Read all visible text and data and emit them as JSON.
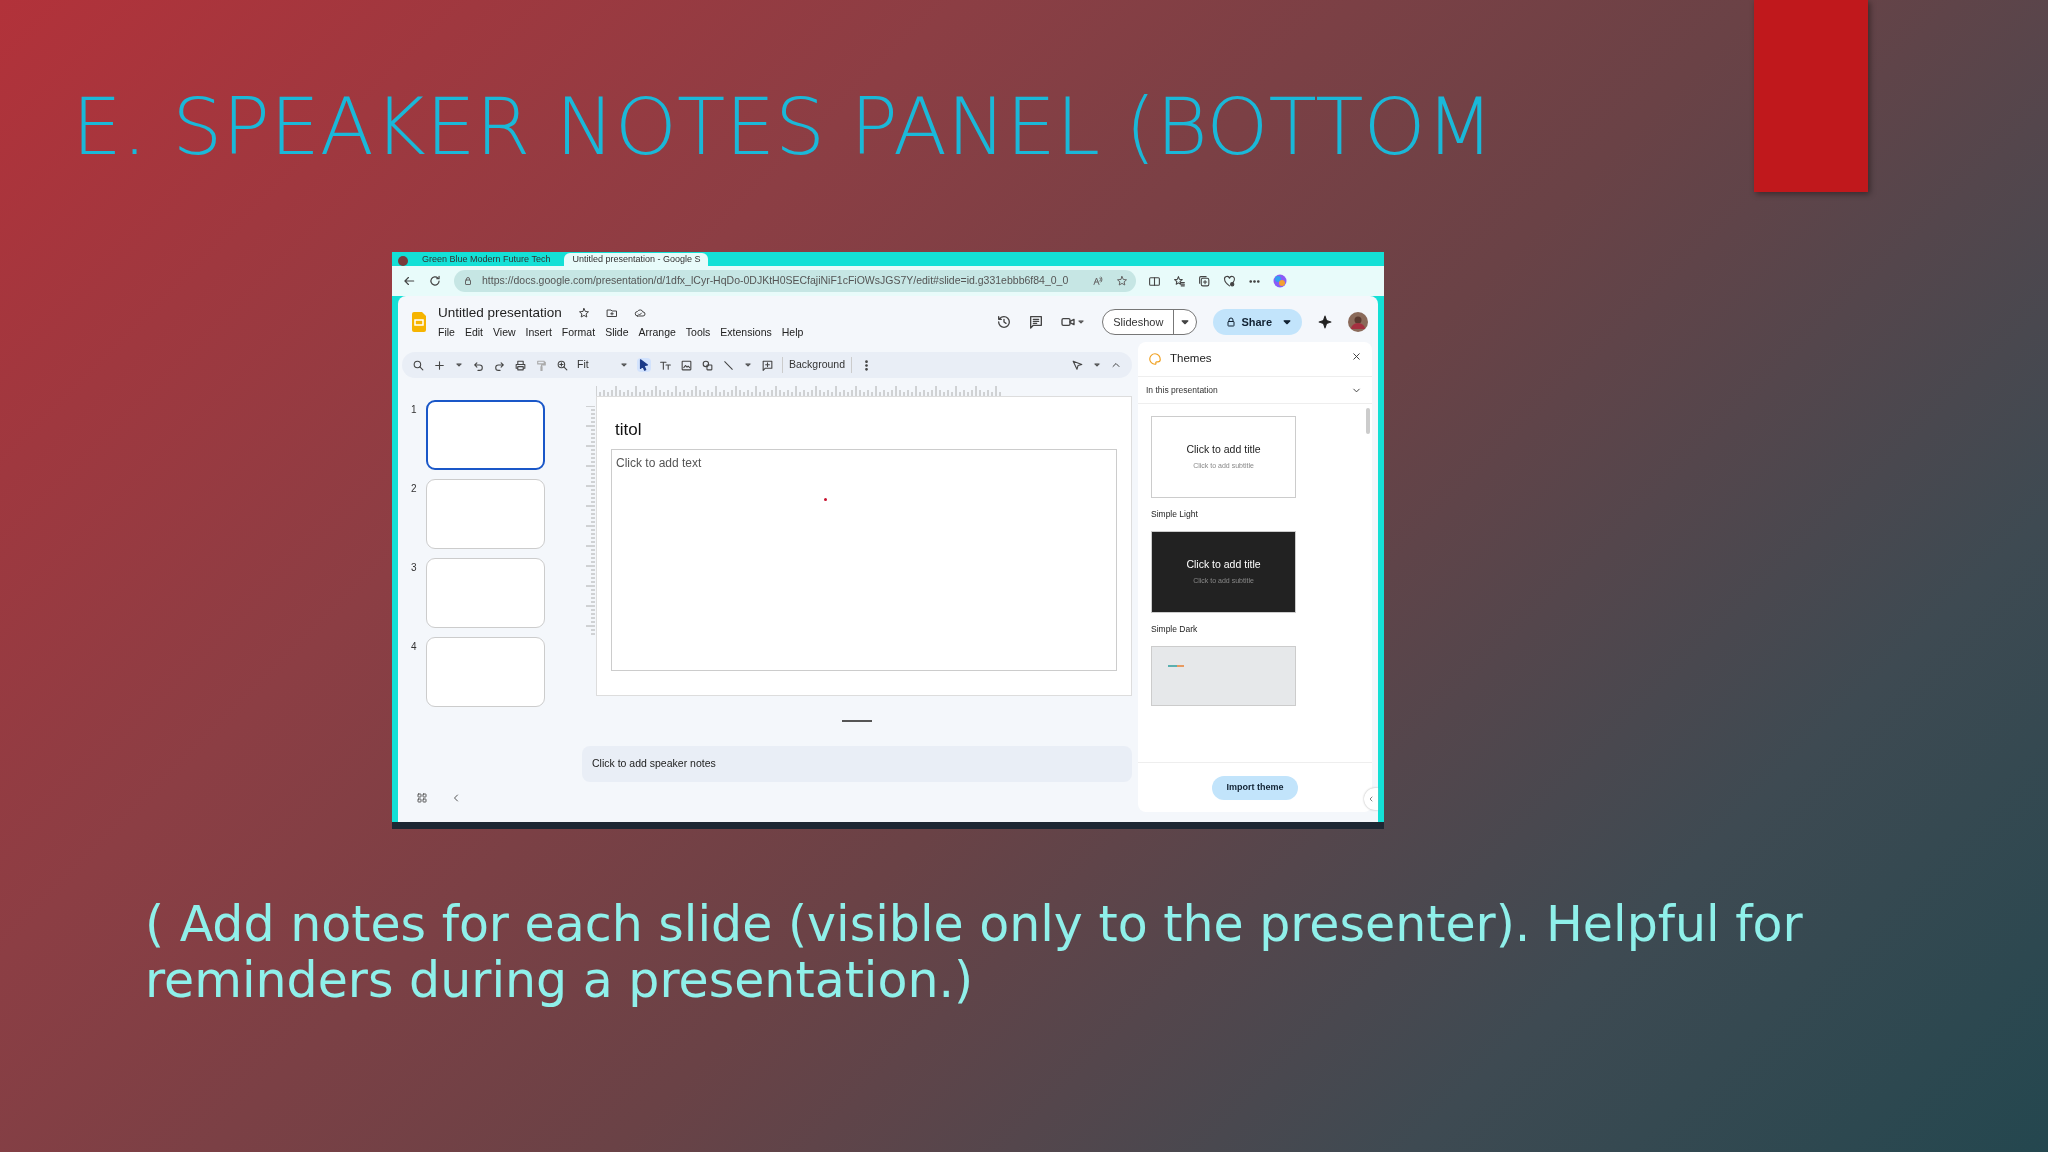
{
  "slide_title": "E. SPEAKER NOTES PANEL (BOTTOM",
  "screenshot": {
    "browser_tabs": [
      {
        "title": "Green Blue Modern Future Tech",
        "selected": false
      },
      {
        "title": "Untitled presentation - Google S",
        "selected": true
      }
    ],
    "url": "https://docs.google.com/presentation/d/1dfx_lCyr-HqDo-0DJKtH0SECfajiNiF1cFiOWsJGS7Y/edit#slide=id.g331ebbb6f84_0_0",
    "doc_title": "Untitled presentation",
    "menu": [
      "File",
      "Edit",
      "View",
      "Insert",
      "Format",
      "Slide",
      "Arrange",
      "Tools",
      "Extensions",
      "Help"
    ],
    "slideshow_button": "Slideshow",
    "share_button": "Share",
    "zoom": "Fit",
    "background_button": "Background",
    "slides": [
      {
        "number": "1",
        "selected": true
      },
      {
        "number": "2",
        "selected": false
      },
      {
        "number": "3",
        "selected": false
      },
      {
        "number": "4",
        "selected": false
      }
    ],
    "slide": {
      "title": "titol",
      "body_placeholder": "Click to add text"
    },
    "notes_placeholder": "Click to add speaker notes",
    "themes": {
      "title": "Themes",
      "filter": "In this presentation",
      "items": [
        {
          "kind": "light",
          "name": "Simple Light",
          "title": "Click to add title",
          "subtitle": "Click to add subtitle"
        },
        {
          "kind": "dark",
          "name": "Simple Dark",
          "title": "Click to add title",
          "subtitle": "Click to add subtitle"
        },
        {
          "kind": "partial"
        }
      ],
      "import_button": "Import theme"
    }
  },
  "caption": "( Add notes for each slide (visible only to the presenter). Helpful for reminders during a presentation.)"
}
